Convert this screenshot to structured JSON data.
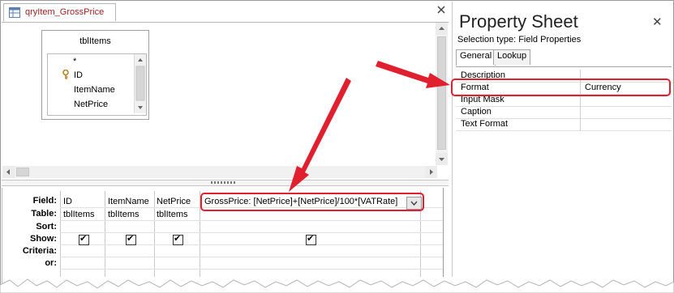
{
  "query_tab": {
    "title": "qryItem_GrossPrice",
    "icon": "query-icon",
    "close_icon": "close-icon"
  },
  "field_list": {
    "table_name": "tblItems",
    "items": [
      {
        "label": "*",
        "key": false
      },
      {
        "label": "ID",
        "key": true
      },
      {
        "label": "ItemName",
        "key": false
      },
      {
        "label": "NetPrice",
        "key": false
      }
    ]
  },
  "grid": {
    "row_labels": [
      "Field:",
      "Table:",
      "Sort:",
      "Show:",
      "Criteria:",
      "or:"
    ],
    "columns": [
      {
        "field": "ID",
        "table": "tblItems",
        "show": true
      },
      {
        "field": "ItemName",
        "table": "tblItems",
        "show": true
      },
      {
        "field": "NetPrice",
        "table": "tblItems",
        "show": true
      },
      {
        "field": "GrossPrice: [NetPrice]+[NetPrice]/100*[VATRate]",
        "table": "",
        "show": true
      }
    ]
  },
  "property_sheet": {
    "title": "Property Sheet",
    "selection_type": "Selection type:  Field Properties",
    "tabs": [
      "General",
      "Lookup"
    ],
    "active_tab": "General",
    "rows": [
      {
        "name": "Description",
        "value": ""
      },
      {
        "name": "Format",
        "value": "Currency"
      },
      {
        "name": "Input Mask",
        "value": ""
      },
      {
        "name": "Caption",
        "value": ""
      },
      {
        "name": "Text Format",
        "value": ""
      }
    ]
  },
  "colors": {
    "highlight": "#e0202e",
    "arrow": "#e0202e",
    "tab_text": "#9b1f1f"
  }
}
